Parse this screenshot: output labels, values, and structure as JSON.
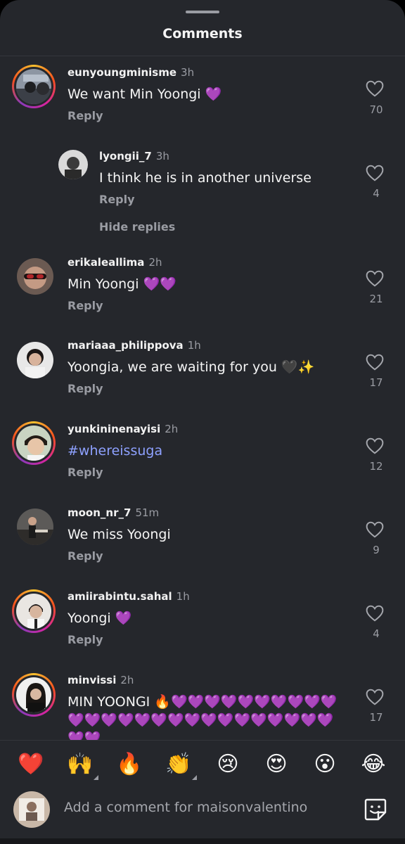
{
  "header": {
    "title": "Comments"
  },
  "comments": [
    {
      "username": "eunyoungminisme",
      "time": "3h",
      "text": "We want Min Yoongi 💜",
      "reply": "Reply",
      "likes": "70"
    },
    {
      "username": "lyongii_7",
      "time": "3h",
      "text": "I think he is in another universe",
      "reply": "Reply",
      "likes": "4"
    },
    {
      "username": "erikaleallima",
      "time": "2h",
      "text": "Min Yoongi 💜💜",
      "reply": "Reply",
      "likes": "21"
    },
    {
      "username": "mariaaa_philippova",
      "time": "1h",
      "text": "Yoongia, we are waiting for you 🖤✨",
      "reply": "Reply",
      "likes": "17"
    },
    {
      "username": "yunkininenayisi",
      "time": "2h",
      "text": "#whereissuga",
      "reply": "Reply",
      "likes": "12"
    },
    {
      "username": "moon_nr_7",
      "time": "51m",
      "text": "We miss Yoongi",
      "reply": "Reply",
      "likes": "9"
    },
    {
      "username": "amiirabintu.sahal",
      "time": "1h",
      "text": "Yoongi 💜",
      "reply": "Reply",
      "likes": "4"
    },
    {
      "username": "minvissi",
      "time": "2h",
      "text": "MIN YOONGI 🔥💜💜💜💜💜💜💜💜💜💜💜💜💜💜💜💜💜💜💜💜💜💜💜💜💜💜💜💜",
      "reply": "Reply",
      "likes": "17"
    }
  ],
  "thread": {
    "hide_replies": "Hide replies"
  },
  "reactions": [
    "❤️",
    "🙌",
    "🔥",
    "👏",
    "😢",
    "😍",
    "😮",
    "😂"
  ],
  "composer": {
    "placeholder": "Add a comment for maisonvalentino"
  },
  "icons": {
    "like": "heart-outline-icon",
    "sticker": "sticker-icon"
  },
  "colors": {
    "background": "#25272c",
    "hashtag": "#8ea1ff",
    "muted": "#9a9ca3"
  }
}
